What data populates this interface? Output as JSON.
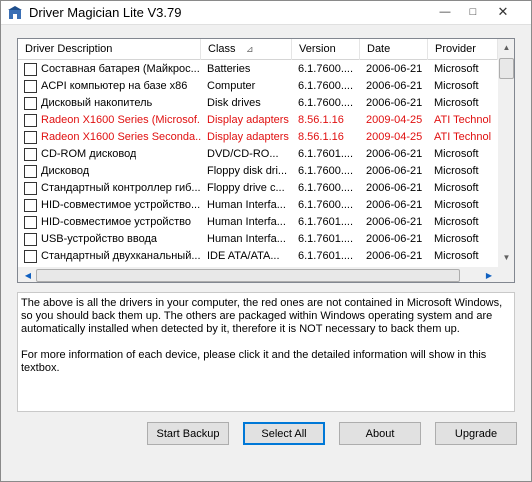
{
  "window": {
    "title": "Driver Magician Lite V3.79",
    "controls": {
      "minimize": "—",
      "maximize": "□",
      "close": "✕"
    }
  },
  "list": {
    "columns": [
      "Driver Description",
      "Class",
      "Version",
      "Date",
      "Provider"
    ],
    "sort_indicator": "⊿",
    "rows": [
      {
        "desc": "Составная батарея (Майкрос...",
        "class": "Batteries",
        "version": "6.1.7600....",
        "date": "2006-06-21",
        "provider": "Microsoft",
        "highlight": false
      },
      {
        "desc": "ACPI компьютер на базе x86",
        "class": "Computer",
        "version": "6.1.7600....",
        "date": "2006-06-21",
        "provider": "Microsoft",
        "highlight": false
      },
      {
        "desc": "Дисковый накопитель",
        "class": "Disk drives",
        "version": "6.1.7600....",
        "date": "2006-06-21",
        "provider": "Microsoft",
        "highlight": false
      },
      {
        "desc": "Radeon X1600 Series (Microsof...",
        "class": "Display adapters",
        "version": "8.56.1.16",
        "date": "2009-04-25",
        "provider": "ATI Technol",
        "highlight": true
      },
      {
        "desc": "Radeon X1600 Series Seconda...",
        "class": "Display adapters",
        "version": "8.56.1.16",
        "date": "2009-04-25",
        "provider": "ATI Technol",
        "highlight": true
      },
      {
        "desc": "CD-ROM дисковод",
        "class": "DVD/CD-RO...",
        "version": "6.1.7601....",
        "date": "2006-06-21",
        "provider": "Microsoft",
        "highlight": false
      },
      {
        "desc": "Дисковод",
        "class": "Floppy disk dri...",
        "version": "6.1.7600....",
        "date": "2006-06-21",
        "provider": "Microsoft",
        "highlight": false
      },
      {
        "desc": "Стандартный контроллер гиб...",
        "class": "Floppy drive c...",
        "version": "6.1.7600....",
        "date": "2006-06-21",
        "provider": "Microsoft",
        "highlight": false
      },
      {
        "desc": "HID-совместимое устройство...",
        "class": "Human Interfa...",
        "version": "6.1.7600....",
        "date": "2006-06-21",
        "provider": "Microsoft",
        "highlight": false
      },
      {
        "desc": "HID-совместимое устройство",
        "class": "Human Interfa...",
        "version": "6.1.7601....",
        "date": "2006-06-21",
        "provider": "Microsoft",
        "highlight": false
      },
      {
        "desc": "USB-устройство ввода",
        "class": "Human Interfa...",
        "version": "6.1.7601....",
        "date": "2006-06-21",
        "provider": "Microsoft",
        "highlight": false
      },
      {
        "desc": "Стандартный двухканальный...",
        "class": "IDE ATA/ATA...",
        "version": "6.1.7601....",
        "date": "2006-06-21",
        "provider": "Microsoft",
        "highlight": false
      }
    ]
  },
  "info": {
    "paragraph1": "The above is all the drivers in your computer, the red ones are not contained in Microsoft Windows, so you should back them up. The others are packaged within Windows operating system and are automatically installed when detected by it, therefore it is NOT necessary to back them up.",
    "paragraph2": "For more information of each device, please click it and the detailed information will show in this textbox."
  },
  "buttons": {
    "start_backup": "Start Backup",
    "select_all": "Select All",
    "about": "About",
    "upgrade": "Upgrade"
  },
  "colors": {
    "highlight_text": "#e01010",
    "window_bg": "#f0f0f0",
    "focus_border": "#0078d7"
  }
}
